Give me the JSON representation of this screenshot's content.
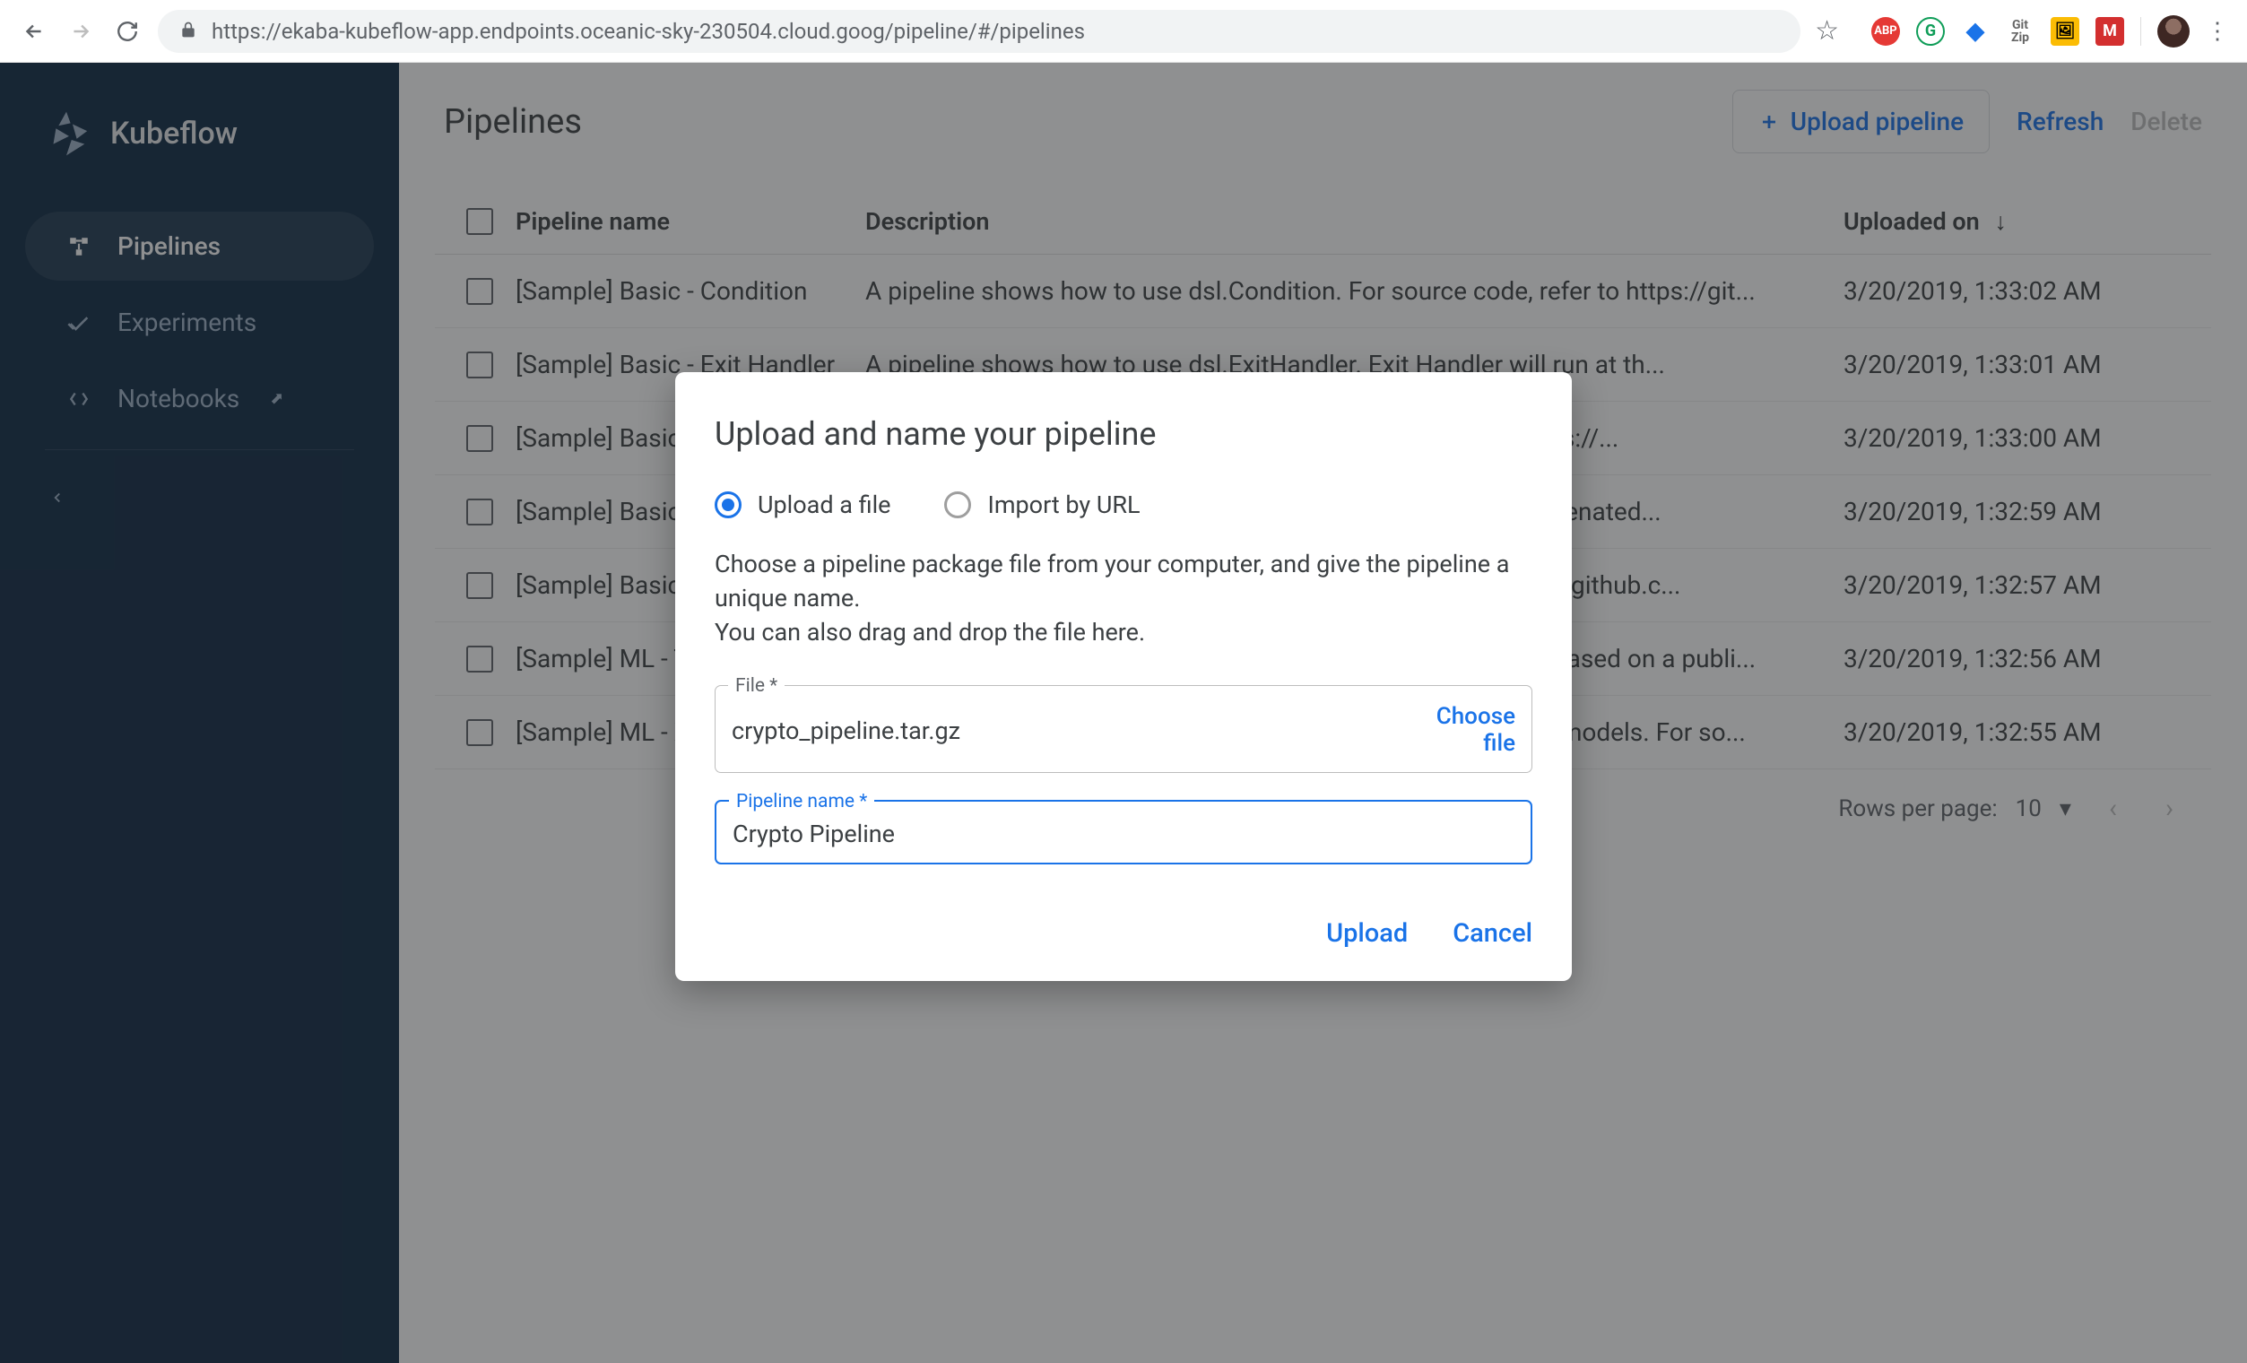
{
  "browser": {
    "url": "https://ekaba-kubeflow-app.endpoints.oceanic-sky-230504.cloud.goog/pipeline/#/pipelines"
  },
  "sidebar": {
    "brand": "Kubeflow",
    "items": [
      {
        "label": "Pipelines"
      },
      {
        "label": "Experiments"
      },
      {
        "label": "Notebooks"
      }
    ]
  },
  "header": {
    "title": "Pipelines",
    "upload_label": "Upload pipeline",
    "refresh_label": "Refresh",
    "delete_label": "Delete"
  },
  "table": {
    "columns": {
      "name": "Pipeline name",
      "description": "Description",
      "uploaded": "Uploaded on"
    },
    "rows": [
      {
        "name": "[Sample] Basic - Condition",
        "desc": "A pipeline shows how to use dsl.Condition. For source code, refer to https://git...",
        "date": "3/20/2019, 1:33:02 AM"
      },
      {
        "name": "[Sample] Basic - Exit Handler",
        "desc": "A pipeline shows how to use dsl.ExitHandler. Exit Handler will run at th...",
        "date": "3/20/2019, 1:33:01 AM"
      },
      {
        "name": "[Sample] Basic - Immediate Value",
        "desc": "A pipeline with parameter values. For source code, refer to https://...",
        "date": "3/20/2019, 1:33:00 AM"
      },
      {
        "name": "[Sample] Basic - Parallel Join",
        "desc": "A pipeline that downloads two messages and prints the concatenated...",
        "date": "3/20/2019, 1:32:59 AM"
      },
      {
        "name": "[Sample] Basic - Sequential",
        "desc": "A pipeline with two sequential steps. For source refer to https://github.c...",
        "date": "3/20/2019, 1:32:57 AM"
      },
      {
        "name": "[Sample] ML - TFX - Taxi Tip Prediction",
        "desc": "Example pipeline that does classification with model analysis based on a publi...",
        "date": "3/20/2019, 1:32:56 AM"
      },
      {
        "name": "[Sample] ML - XGBoost - Training with Confusion Matrix",
        "desc": "A trainer that does end-to-end distributed training for XGBoost models. For so...",
        "date": "3/20/2019, 1:32:55 AM"
      }
    ],
    "footer": {
      "rows_per_page_label": "Rows per page:",
      "rows_per_page_value": "10"
    }
  },
  "dialog": {
    "title": "Upload and name your pipeline",
    "radio_upload": "Upload a file",
    "radio_import": "Import by URL",
    "help_line1": "Choose a pipeline package file from your computer, and give the pipeline a unique name.",
    "help_line2": "You can also drag and drop the file here.",
    "file": {
      "label": "File *",
      "value": "crypto_pipeline.tar.gz",
      "choose_label": "Choose file"
    },
    "name": {
      "label": "Pipeline name *",
      "value": "Crypto Pipeline"
    },
    "upload_btn": "Upload",
    "cancel_btn": "Cancel"
  }
}
